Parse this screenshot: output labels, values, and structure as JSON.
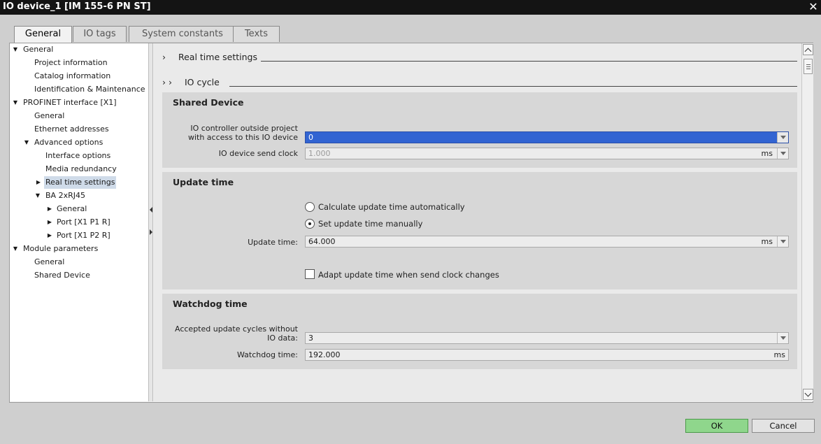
{
  "window": {
    "title": "IO device_1 [IM 155-6 PN ST]",
    "close_glyph": "✕"
  },
  "tabs": [
    "General",
    "IO tags",
    "System constants",
    "Texts"
  ],
  "tree": [
    {
      "label": "General",
      "arrow": "▼"
    },
    {
      "label": "Project information",
      "arrow": ""
    },
    {
      "label": "Catalog information",
      "arrow": ""
    },
    {
      "label": "Identification & Maintenance",
      "arrow": ""
    },
    {
      "label": "PROFINET interface [X1]",
      "arrow": "▼"
    },
    {
      "label": "General",
      "arrow": ""
    },
    {
      "label": "Ethernet addresses",
      "arrow": ""
    },
    {
      "label": "Advanced options",
      "arrow": "▼"
    },
    {
      "label": "Interface options",
      "arrow": ""
    },
    {
      "label": "Media redundancy",
      "arrow": ""
    },
    {
      "label": "Real time settings",
      "arrow": "▶",
      "selected": true
    },
    {
      "label": "BA 2xRJ45",
      "arrow": "▼"
    },
    {
      "label": "General",
      "arrow": "▶"
    },
    {
      "label": "Port [X1 P1 R]",
      "arrow": "▶"
    },
    {
      "label": "Port [X1 P2 R]",
      "arrow": "▶"
    },
    {
      "label": "Module parameters",
      "arrow": "▼"
    },
    {
      "label": "General",
      "arrow": ""
    },
    {
      "label": "Shared Device",
      "arrow": ""
    }
  ],
  "content": {
    "section_real_time": {
      "arrow": "›",
      "label": "Real time settings"
    },
    "section_io_cycle": {
      "arrow": "› ›",
      "label": "IO cycle"
    },
    "shared_device": {
      "title": "Shared Device",
      "controller_label_1": "IO controller outside project",
      "controller_label_2": "with access to this IO device",
      "controller_value": "0",
      "send_clock_label": "IO device send clock",
      "send_clock_value": "1.000",
      "send_clock_unit": "ms"
    },
    "update_time": {
      "title": "Update time",
      "auto_label": "Calculate update time automatically",
      "auto_selected": false,
      "manual_label": "Set update time manually",
      "manual_selected": true,
      "time_label": "Update time:",
      "time_value": "64.000",
      "time_unit": "ms",
      "adapt_label": "Adapt update time when send clock changes",
      "adapt_checked": false
    },
    "watchdog": {
      "title": "Watchdog time",
      "cycles_label_1": "Accepted update cycles without",
      "cycles_label_2": "IO data:",
      "cycles_value": "3",
      "time_label": "Watchdog time:",
      "time_value": "192.000",
      "time_unit": "ms"
    }
  },
  "buttons": {
    "ok": "OK",
    "cancel": "Cancel"
  },
  "colors": {
    "selection": "#3264d2",
    "ok_button": "#8fd68c",
    "titlebar": "#141414"
  }
}
